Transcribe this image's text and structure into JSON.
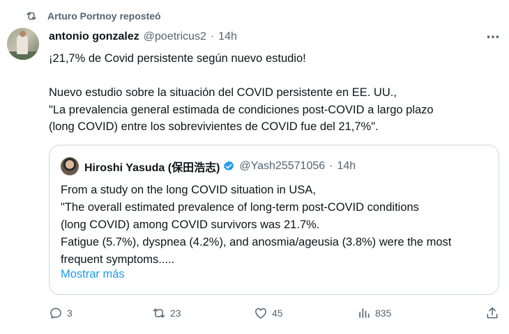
{
  "repost": {
    "text": "Arturo Portnoy reposteó"
  },
  "tweet": {
    "name": "antonio gonzalez",
    "handle": "@poetricus2",
    "dot": "·",
    "time": "14h",
    "lines": [
      "¡21,7% de Covid persistente según nuevo estudio!",
      "Nuevo estudio sobre la situación del COVID persistente en EE. UU.,",
      "\"La prevalencia general estimada de condiciones post-COVID a largo plazo",
      "(long COVID) entre los sobrevivientes de COVID fue del 21,7%\"."
    ]
  },
  "quote": {
    "name": "Hiroshi Yasuda (保田浩志)",
    "handle": "@Yash25571056",
    "dot": "·",
    "time": "14h",
    "lines": [
      "From a study on the long COVID situation in USA,",
      "\"The overall estimated prevalence of long-term post-COVID conditions",
      "(long COVID) among COVID survivors was 21.7%.",
      "Fatigue (5.7%), dyspnea (4.2%), and anosmia/ageusia (3.8%) were the most",
      "frequent symptoms....."
    ],
    "show_more": "Mostrar más"
  },
  "actions": {
    "replies": "3",
    "reposts": "23",
    "likes": "45",
    "views": "835"
  },
  "colors": {
    "link": "#1d9bf0",
    "muted": "#536471",
    "text": "#0f1419",
    "border": "#cfd9de"
  },
  "icons": [
    "repost-icon",
    "more-icon",
    "verified-icon",
    "reply-icon",
    "like-icon",
    "views-icon",
    "share-icon"
  ]
}
